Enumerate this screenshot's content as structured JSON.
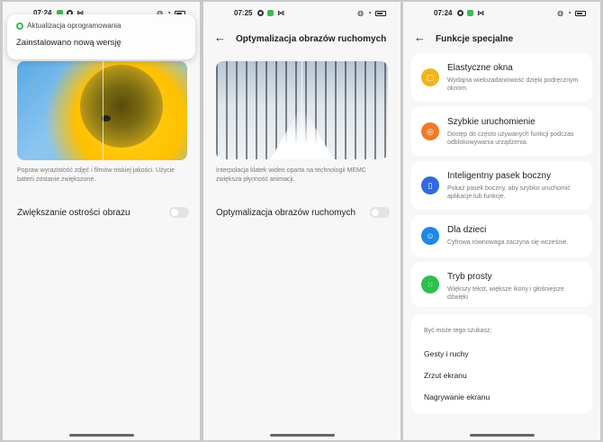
{
  "screen1": {
    "status": {
      "time": "07:24"
    },
    "notification": {
      "app": "Aktualizacja oprogramowania",
      "message": "Zainstalowano nową wersję"
    },
    "description": "Popraw wyrazistość zdjęć i filmów niskiej jakości. Użycie baterii zostanie zwiększone.",
    "setting_label": "Zwiększanie ostrości obrazu",
    "setting_enabled": false
  },
  "screen2": {
    "status": {
      "time": "07:25"
    },
    "title": "Optymalizacja obrazów ruchomych",
    "description": "Interpolacja klatek wideo oparta na technologii MEMC zwiększa płynność animacji.",
    "setting_label": "Optymalizacja obrazów ruchomych",
    "setting_enabled": false
  },
  "screen3": {
    "status": {
      "time": "07:24"
    },
    "title": "Funkcje specjalne",
    "features": [
      {
        "title": "Elastyczne okna",
        "desc": "Wydajna wielozadaniowość dzięki podręcznym oknom.",
        "icon": "flexible-window-icon",
        "color": "#f4b31a"
      },
      {
        "title": "Szybkie uruchomienie",
        "desc": "Dostęp do często używanych funkcji podczas odblokowywania urządzenia.",
        "icon": "quick-launch-icon",
        "color": "#f07a2a"
      },
      {
        "title": "Inteligentny pasek boczny",
        "desc": "Pokaż pasek boczny, aby szybko uruchomić aplikacje lub funkcje.",
        "icon": "sidebar-icon",
        "color": "#2f6be0"
      },
      {
        "title": "Dla dzieci",
        "desc": "Cyfrowa równowaga zaczyna się wcześnie.",
        "icon": "kids-icon",
        "color": "#1e88e5"
      },
      {
        "title": "Tryb prosty",
        "desc": "Większy tekst, większe ikony i głośniejsze dźwięki",
        "icon": "simple-mode-icon",
        "color": "#2fbf4f"
      }
    ],
    "suggestions_header": "Być może tego szukasz:",
    "suggestions": [
      "Gesty i ruchy",
      "Zrzut ekranu",
      "Nagrywanie ekranu"
    ]
  }
}
